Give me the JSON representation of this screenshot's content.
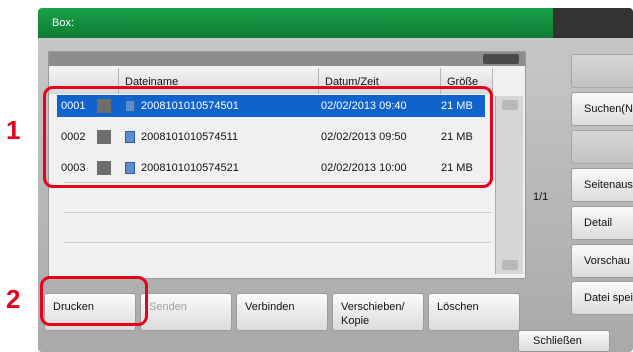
{
  "callouts": [
    "1",
    "2"
  ],
  "window": {
    "title": "Box:"
  },
  "columns": {
    "name": "Dateiname",
    "date": "Datum/Zeit",
    "size": "Größe"
  },
  "files": [
    {
      "no": "0001",
      "name": "2008101010574501",
      "date": "02/02/2013 09:40",
      "size": "21 MB",
      "selected": true
    },
    {
      "no": "0002",
      "name": "2008101010574511",
      "date": "02/02/2013 09:50",
      "size": "21 MB",
      "selected": false
    },
    {
      "no": "0003",
      "name": "2008101010574521",
      "date": "02/02/2013 10:00",
      "size": "21 MB",
      "selected": false
    }
  ],
  "pagination": {
    "label": "1/1"
  },
  "side_buttons": {
    "search_name": "Suchen(Name)",
    "page_select": "Seitenauswahl",
    "detail": "Detail",
    "preview": "Vorschau",
    "save_file": "Datei speich."
  },
  "bottom_buttons": {
    "print": "Drucken",
    "send": "Senden",
    "join": "Verbinden",
    "move_copy_line1": "Verschieben/",
    "move_copy_line2": "Kopie",
    "delete": "Löschen"
  },
  "close_button": "Schließen",
  "colors": {
    "accent": "#1163cc",
    "titlebar": "#14903f",
    "callout": "#e8001c"
  }
}
